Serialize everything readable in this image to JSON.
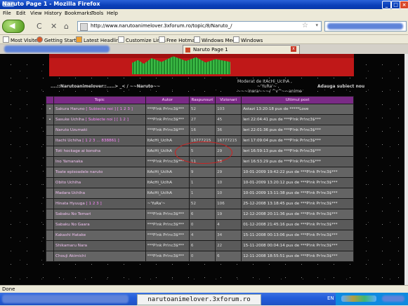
{
  "window": {
    "title": "Naruto Page 1 - Mozilla Firefox",
    "min": "_",
    "max": "□",
    "close": "×"
  },
  "menu": [
    "File",
    "Edit",
    "View",
    "History",
    "Bookmarks",
    "Tools",
    "Help"
  ],
  "nav": {
    "back": "◀",
    "reload": "C",
    "stop": "✕",
    "home": "⌂",
    "url": "http://www.narutoanimelover.3xforum.ro/topic/8/Naruto_/",
    "star": "☆",
    "dropdown": "▾"
  },
  "bookmarks": [
    "Most Visited",
    "Getting Started",
    "Latest Headlines",
    "Customize Links",
    "Free Hotmail",
    "Windows Media",
    "Windows"
  ],
  "tab": {
    "label": "Naruto Page 1",
    "close": "x"
  },
  "forum": {
    "breadcrumb": "....::Narutoanimelover::.....> _< / ~~Naruto~~",
    "moderator": [
      "Moderat de ItAcHi_UcIhA ,",
      "~'YuRa'~ ,",
      "~~~inora~~~/ ^v^~~anime"
    ],
    "add_topic": "Adauga subiect nou",
    "headers": {
      "topic": "Topic",
      "author": "Autor",
      "replies": "Raspunsuri",
      "views": "Vizionari",
      "last": "Ultimul post"
    },
    "rows": [
      {
        "bullet": "•",
        "title": "Sakura Haruno",
        "extra": "[ Subiecte noi ] [ 1 2 3 ]",
        "author": "***P!nk Pr!nc3$***",
        "replies": "52",
        "views": "103",
        "last": "Astazi 13:20:18 pus de *****Love"
      },
      {
        "bullet": "•",
        "title": "Sasuke Uchiha",
        "extra": "[ Subiecte noi ] [ 1 2 ]",
        "author": "***P!nk Pr!nc3$***",
        "replies": "27",
        "views": "45",
        "last": "Ieri 22:04:41 pus de ***P!nk Pr!nc3$***"
      },
      {
        "bullet": "",
        "title": "Naruto Uzumaki",
        "extra": "",
        "author": "***P!nk Pr!nc3$***",
        "replies": "16",
        "views": "36",
        "last": "Ieri 22:01:36 pus de ***P!nk Pr!nc3$***"
      },
      {
        "bullet": "",
        "title": "Itachi Uchiha",
        "extra": "[ 1 2 3 ... 838861 ]",
        "author": "ItAcHi_UcIhA",
        "replies": "16777215",
        "views": "16777215",
        "last": "Ieri 17:09:04 pus de ***P!nk Pr!nc3$***"
      },
      {
        "bullet": "",
        "title": "Toti hockage ai konoha",
        "extra": "",
        "author": "ItAcHi_UcIhA",
        "replies": "5",
        "views": "29",
        "last": "Ieri 16:59:13 pus de ***P!nk Pr!nc3$***"
      },
      {
        "bullet": "",
        "title": "Ino Yamanaka",
        "extra": "",
        "author": "***P!nk Pr!nc3$***",
        "replies": "11",
        "views": "38",
        "last": "Ieri 16:53:29 pus de ***P!nk Pr!nc3$***"
      },
      {
        "bullet": "",
        "title": "Toate episoadele naruto",
        "extra": "",
        "author": "ItAcHi_UcIhA",
        "replies": "9",
        "views": "29",
        "last": "10-01-2009 19:42:22 pus de ***P!nk Pr!nc3$***"
      },
      {
        "bullet": "",
        "title": "Obito Uchiha",
        "extra": "",
        "author": "ItAcHi_UcIhA",
        "replies": "1",
        "views": "10",
        "last": "10-01-2009 13:20:12 pus de ***P!nk Pr!nc3$***"
      },
      {
        "bullet": "",
        "title": "Madara Uchiha",
        "extra": "",
        "author": "ItAcHi_UcIhA",
        "replies": "1",
        "views": "10",
        "last": "10-01-2009 13:11:38 pus de ***P!nk Pr!nc3$***"
      },
      {
        "bullet": "",
        "title": "Hinata Hyuuga",
        "extra": "[ 1 2 3 ]",
        "author": "~'YuRa'~",
        "replies": "52",
        "views": "106",
        "last": "25-12-2008 13:18:45 pus de ***P!nk Pr!nc3$***"
      },
      {
        "bullet": "",
        "title": "Sabaku No Temari",
        "extra": "",
        "author": "***P!nk Pr!nc3$***",
        "replies": "6",
        "views": "19",
        "last": "12-12-2008 20:11:36 pus de ***P!nk Pr!nc3$***"
      },
      {
        "bullet": "",
        "title": "Sabaku No Gaara",
        "extra": "",
        "author": "***P!nk Pr!nc3$***",
        "replies": "0",
        "views": "4",
        "last": "01-12-2008 21:45:16 pus de ***P!nk Pr!nc3$***"
      },
      {
        "bullet": "",
        "title": "Kakashi Hatake",
        "extra": "",
        "author": "***P!nk Pr!nc3$***",
        "replies": "4",
        "views": "34",
        "last": "15-11-2008 00:13:06 pus de ***P!nk Pr!nc3$***"
      },
      {
        "bullet": "",
        "title": "Shikamaru Nara",
        "extra": "",
        "author": "***P!nk Pr!nc3$***",
        "replies": "6",
        "views": "22",
        "last": "15-11-2008 00:04:14 pus de ***P!nk Pr!nc3$***"
      },
      {
        "bullet": "",
        "title": "Chouji Akimichi",
        "extra": "",
        "author": "***P!nk Pr!nc3$***",
        "replies": "0",
        "views": "6",
        "last": "12-11-2008 18:55:51 pus de ***P!nk Pr!nc3$***"
      }
    ]
  },
  "status": {
    "text": "Done"
  },
  "taskbar": {
    "item": "narutoanimelover.3xforum.ro",
    "lang": "EN"
  }
}
